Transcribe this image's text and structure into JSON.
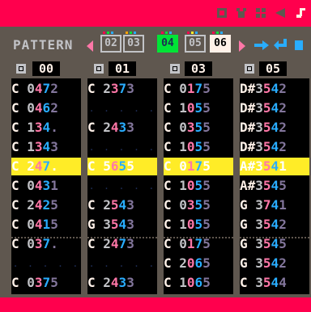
{
  "header": {
    "icons": [
      "code-icon",
      "sprite-icon",
      "map-icon",
      "sfx-icon",
      "music-icon"
    ]
  },
  "pattern_bar": {
    "label": "PATTERN",
    "buttons": [
      "02",
      "03",
      "04",
      "05",
      "06"
    ],
    "selected": "04",
    "active_white": "06"
  },
  "channels": [
    {
      "number": "00",
      "rows": [
        {
          "note": "C",
          "oct": "0",
          "inst": "4",
          "vol": "7",
          "fx": "2"
        },
        {
          "note": "C",
          "oct": "0",
          "inst": "4",
          "vol": "6",
          "fx": "2"
        },
        {
          "note": "C",
          "oct": "1",
          "inst": "3",
          "vol": "4",
          "fx": "."
        },
        {
          "note": "C",
          "oct": "1",
          "inst": "3",
          "vol": "4",
          "fx": "3"
        },
        {
          "note": "C",
          "oct": "2",
          "inst": "4",
          "vol": "7",
          "fx": "."
        },
        {
          "note": "C",
          "oct": "0",
          "inst": "4",
          "vol": "3",
          "fx": "1"
        },
        {
          "note": "C",
          "oct": "2",
          "inst": "4",
          "vol": "2",
          "fx": "5"
        },
        {
          "note": "C",
          "oct": "0",
          "inst": "4",
          "vol": "1",
          "fx": "5"
        },
        {
          "note": "C",
          "oct": "0",
          "inst": "3",
          "vol": "7",
          "fx": "."
        },
        {
          "note": "",
          "oct": "",
          "inst": "",
          "vol": "",
          "fx": ""
        },
        {
          "note": "C",
          "oct": "0",
          "inst": "3",
          "vol": "7",
          "fx": "5"
        }
      ]
    },
    {
      "number": "01",
      "rows": [
        {
          "note": "C",
          "oct": "2",
          "inst": "3",
          "vol": "7",
          "fx": "3"
        },
        {
          "note": "",
          "oct": "",
          "inst": "",
          "vol": "",
          "fx": ""
        },
        {
          "note": "C",
          "oct": "2",
          "inst": "4",
          "vol": "3",
          "fx": "3"
        },
        {
          "note": "",
          "oct": "",
          "inst": "",
          "vol": "",
          "fx": ""
        },
        {
          "note": "C",
          "oct": "5",
          "inst": "6",
          "vol": "5",
          "fx": "5"
        },
        {
          "note": "",
          "oct": "",
          "inst": "",
          "vol": "",
          "fx": ""
        },
        {
          "note": "C",
          "oct": "2",
          "inst": "5",
          "vol": "4",
          "fx": "3"
        },
        {
          "note": "G",
          "oct": "3",
          "inst": "5",
          "vol": "4",
          "fx": "3"
        },
        {
          "note": "C",
          "oct": "2",
          "inst": "4",
          "vol": "7",
          "fx": "3"
        },
        {
          "note": "",
          "oct": "",
          "inst": "",
          "vol": "",
          "fx": ""
        },
        {
          "note": "C",
          "oct": "2",
          "inst": "4",
          "vol": "3",
          "fx": "3"
        }
      ]
    },
    {
      "number": "03",
      "rows": [
        {
          "note": "C",
          "oct": "0",
          "inst": "1",
          "vol": "7",
          "fx": "5"
        },
        {
          "note": "C",
          "oct": "1",
          "inst": "0",
          "vol": "5",
          "fx": "5"
        },
        {
          "note": "C",
          "oct": "0",
          "inst": "3",
          "vol": "5",
          "fx": "5"
        },
        {
          "note": "C",
          "oct": "1",
          "inst": "0",
          "vol": "5",
          "fx": "5"
        },
        {
          "note": "C",
          "oct": "0",
          "inst": "1",
          "vol": "7",
          "fx": "5"
        },
        {
          "note": "C",
          "oct": "1",
          "inst": "0",
          "vol": "5",
          "fx": "5"
        },
        {
          "note": "C",
          "oct": "0",
          "inst": "3",
          "vol": "5",
          "fx": "5"
        },
        {
          "note": "C",
          "oct": "1",
          "inst": "0",
          "vol": "5",
          "fx": "5"
        },
        {
          "note": "C",
          "oct": "0",
          "inst": "1",
          "vol": "7",
          "fx": "5"
        },
        {
          "note": "C",
          "oct": "2",
          "inst": "0",
          "vol": "6",
          "fx": "5"
        },
        {
          "note": "C",
          "oct": "1",
          "inst": "0",
          "vol": "6",
          "fx": "5"
        }
      ]
    },
    {
      "number": "05",
      "rows": [
        {
          "note": "D#",
          "oct": "3",
          "inst": "5",
          "vol": "4",
          "fx": "2"
        },
        {
          "note": "D#",
          "oct": "3",
          "inst": "5",
          "vol": "4",
          "fx": "2"
        },
        {
          "note": "D#",
          "oct": "3",
          "inst": "5",
          "vol": "4",
          "fx": "2"
        },
        {
          "note": "D#",
          "oct": "3",
          "inst": "5",
          "vol": "4",
          "fx": "2"
        },
        {
          "note": "A#",
          "oct": "3",
          "inst": "5",
          "vol": "4",
          "fx": "1"
        },
        {
          "note": "A#",
          "oct": "3",
          "inst": "5",
          "vol": "4",
          "fx": "5"
        },
        {
          "note": "G",
          "oct": "3",
          "inst": "7",
          "vol": "4",
          "fx": "1"
        },
        {
          "note": "G",
          "oct": "3",
          "inst": "5",
          "vol": "4",
          "fx": "2"
        },
        {
          "note": "G",
          "oct": "3",
          "inst": "5",
          "vol": "4",
          "fx": "5"
        },
        {
          "note": "G",
          "oct": "3",
          "inst": "5",
          "vol": "4",
          "fx": "2"
        },
        {
          "note": "C",
          "oct": "3",
          "inst": "5",
          "vol": "4",
          "fx": "4"
        }
      ]
    }
  ],
  "colors": {
    "bar": "#ff004d",
    "bg": "#5f574f",
    "highlight": "#ffec27",
    "selected_pattern": "#00e436"
  }
}
